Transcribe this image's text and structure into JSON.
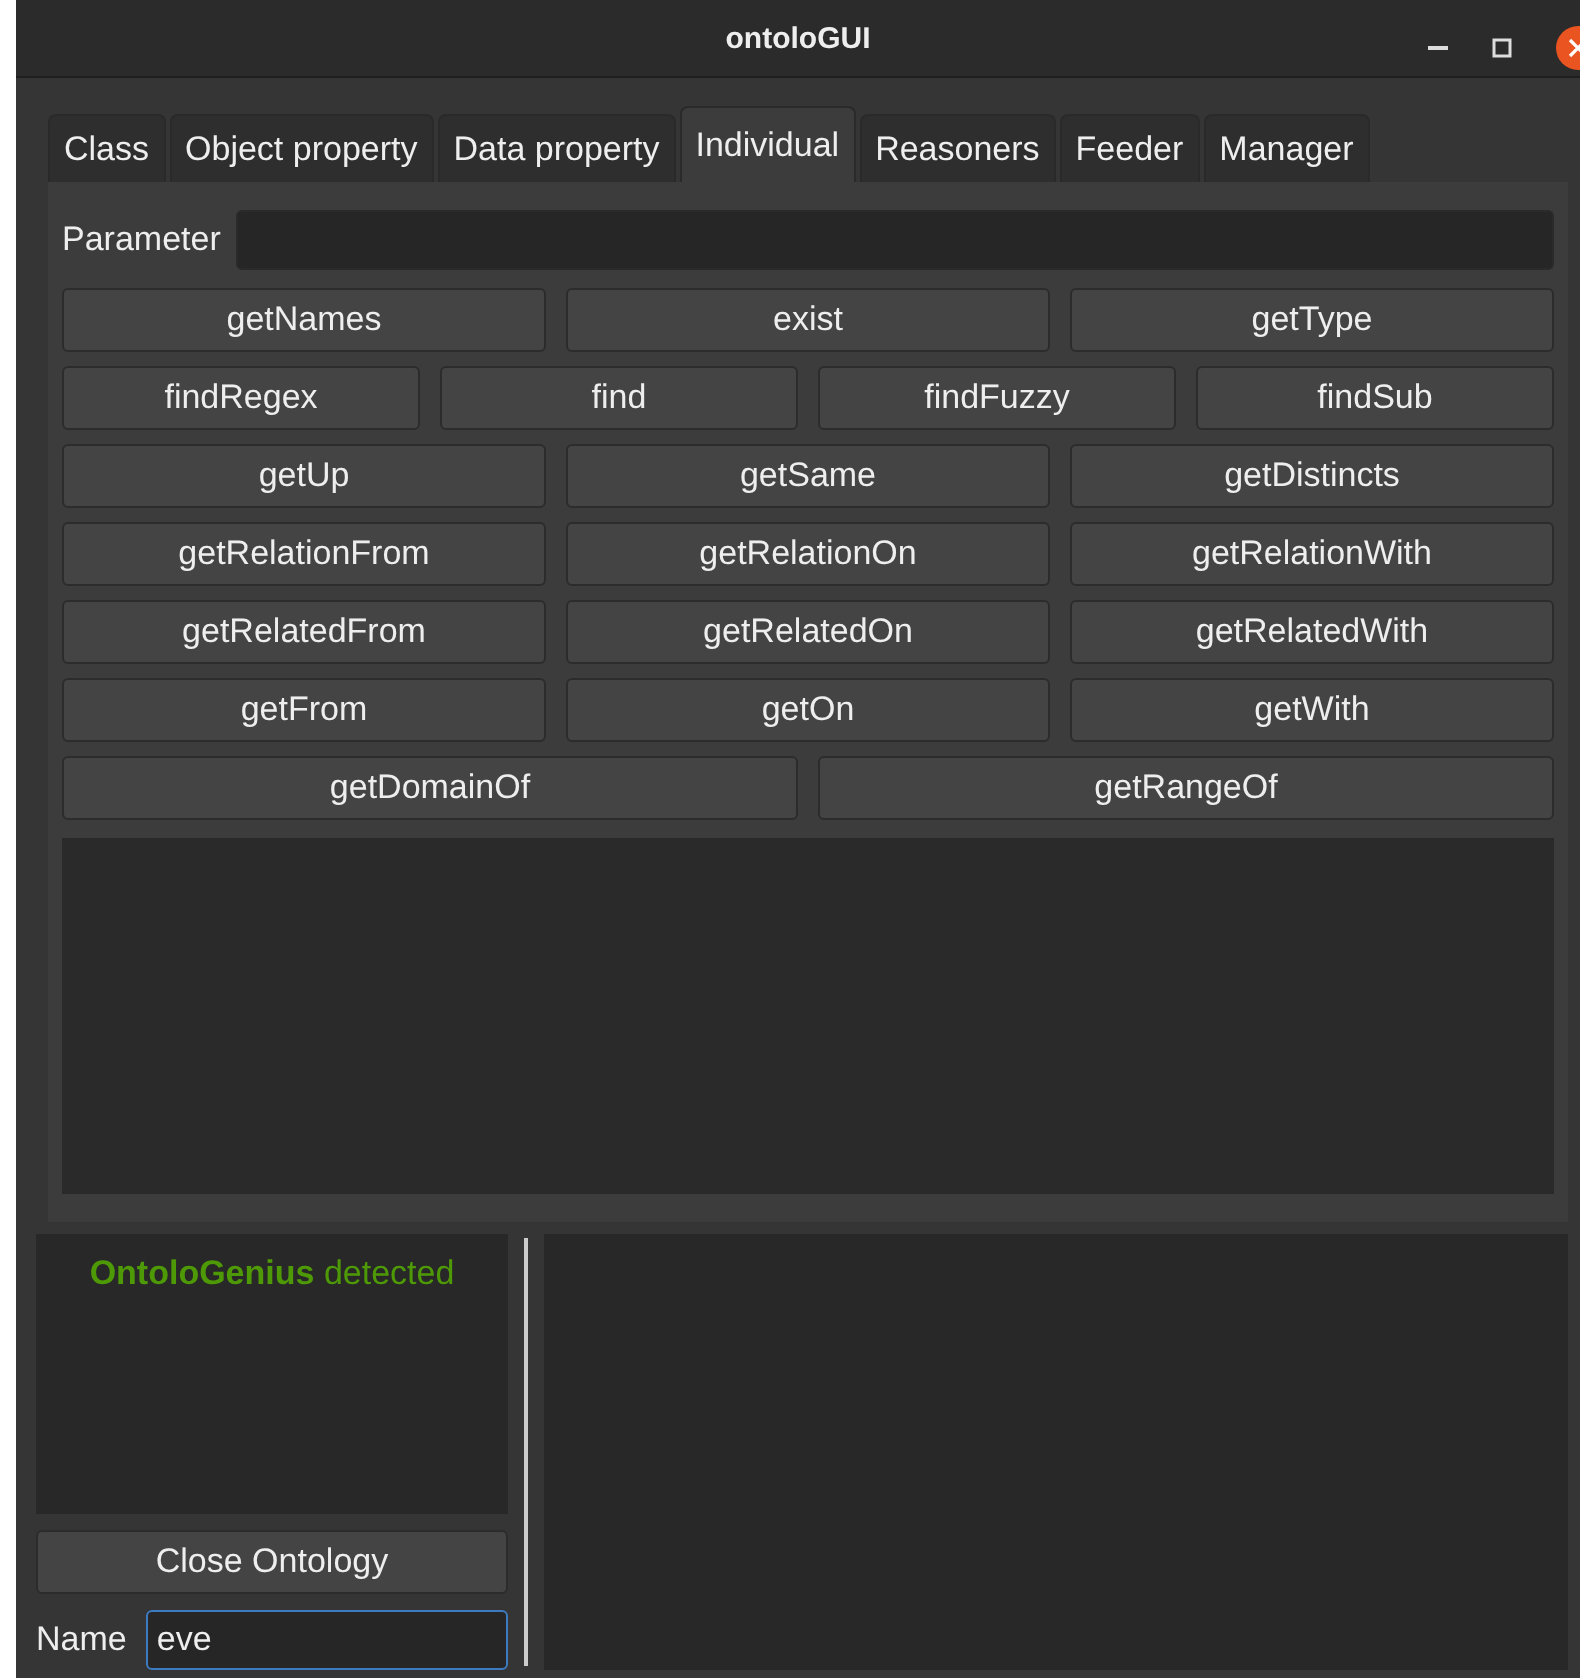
{
  "window": {
    "title": "ontoloGUI"
  },
  "tabs": [
    {
      "label": "Class",
      "selected": false
    },
    {
      "label": "Object property",
      "selected": false
    },
    {
      "label": "Data property",
      "selected": false
    },
    {
      "label": "Individual",
      "selected": true
    },
    {
      "label": "Reasoners",
      "selected": false
    },
    {
      "label": "Feeder",
      "selected": false
    },
    {
      "label": "Manager",
      "selected": false
    }
  ],
  "parameter": {
    "label": "Parameter"
  },
  "button_rows": [
    [
      "getNames",
      "exist",
      "getType"
    ],
    [
      "findRegex",
      "find",
      "findFuzzy",
      "findSub"
    ],
    [
      "getUp",
      "getSame",
      "getDistincts"
    ],
    [
      "getRelationFrom",
      "getRelationOn",
      "getRelationWith"
    ],
    [
      "getRelatedFrom",
      "getRelatedOn",
      "getRelatedWith"
    ],
    [
      "getFrom",
      "getOn",
      "getWith"
    ],
    [
      "getDomainOf",
      "getRangeOf"
    ]
  ],
  "status": {
    "message": "**OntoloGenius** detected"
  },
  "close_button": "Close Ontology",
  "name_field": {
    "label": "Name",
    "value": "eve",
    "focused": true
  }
}
